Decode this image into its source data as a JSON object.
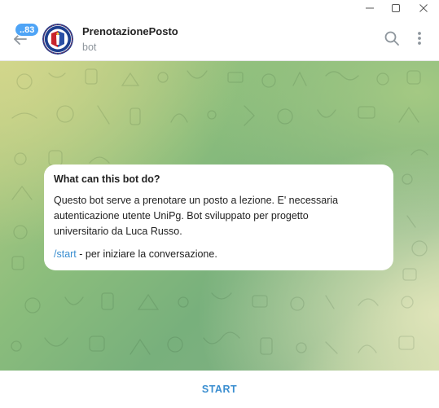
{
  "window": {
    "minimize_icon": "minimize-icon",
    "maximize_icon": "maximize-icon",
    "close_icon": "close-icon"
  },
  "header": {
    "back_icon": "arrow-left-icon",
    "unread_count": "..83",
    "avatar": "university-seal",
    "title": "PrenotazionePosto",
    "subtitle": "bot",
    "search_icon": "search-icon",
    "menu_icon": "more-vertical-icon"
  },
  "card": {
    "heading": "What can this bot do?",
    "description": "Questo bot serve a prenotare un posto a lezione. E' necessaria\nautenticazione utente UniPg. Bot sviluppato per progetto\nuniversitario da Luca Russo.",
    "command": "/start",
    "command_desc": " - per iniziare la conversazione."
  },
  "footer": {
    "start_label": "START"
  },
  "colors": {
    "accent": "#3a8ed0",
    "badge": "#4ea4f6",
    "wallpaper": "#8bbd7c"
  }
}
